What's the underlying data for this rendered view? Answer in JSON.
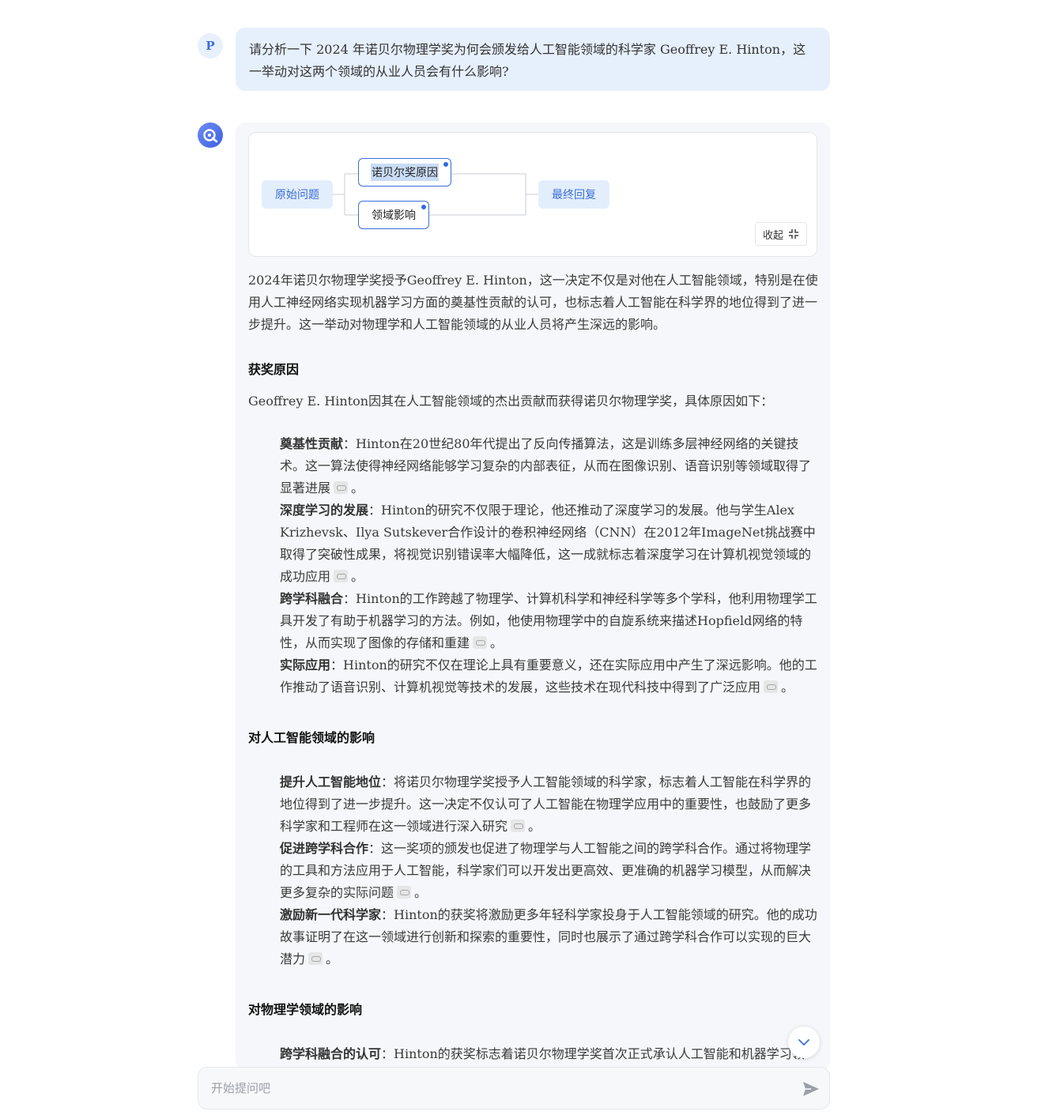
{
  "user_message": {
    "avatar_letter": "P",
    "text": "请分析一下 2024 年诺贝尔物理学奖为何会颁发给人工智能领域的科学家 Geoffrey E. Hinton，这一举动对这两个领域的从业人员会有什么影响?"
  },
  "flow": {
    "start": "原始问题",
    "branches": [
      "诺贝尔奖原因",
      "领域影响"
    ],
    "end": "最终回复",
    "collapse_label": "收起"
  },
  "answer": {
    "intro": "2024年诺贝尔物理学奖授予Geoffrey E. Hinton，这一决定不仅是对他在人工智能领域，特别是在使用人工神经网络实现机器学习方面的奠基性贡献的认可，也标志着人工智能在科学界的地位得到了进一步提升。这一举动对物理学和人工智能领域的从业人员将产生深远的影响。",
    "sections": [
      {
        "title": "获奖原因",
        "lead": "Geoffrey E. Hinton因其在人工智能领域的杰出贡献而获得诺贝尔物理学奖，具体原因如下：",
        "items": [
          {
            "label": "奠基性贡献",
            "sep": "：",
            "text": "Hinton在20世纪80年代提出了反向传播算法，这是训练多层神经网络的关键技术。这一算法使得神经网络能够学习复杂的内部表征，从而在图像识别、语音识别等领域取得了显著进展",
            "end": "。"
          },
          {
            "label": "深度学习的发展",
            "sep": "：",
            "text": "Hinton的研究不仅限于理论，他还推动了深度学习的发展。他与学生Alex Krizhevsk、Ilya Sutskever合作设计的卷积神经网络（CNN）在2012年ImageNet挑战赛中取得了突破性成果，将视觉识别错误率大幅降低，这一成就标志着深度学习在计算机视觉领域的成功应用",
            "end": "。"
          },
          {
            "label": "跨学科融合",
            "sep": "：",
            "text": "Hinton的工作跨越了物理学、计算机科学和神经科学等多个学科，他利用物理学工具开发了有助于机器学习的方法。例如，他使用物理学中的自旋系统来描述Hopfield网络的特性，从而实现了图像的存储和重建",
            "end": "。"
          },
          {
            "label": "实际应用",
            "sep": "：",
            "text": "Hinton的研究不仅在理论上具有重要意义，还在实际应用中产生了深远影响。他的工作推动了语音识别、计算机视觉等技术的发展，这些技术在现代科技中得到了广泛应用",
            "end": "。"
          }
        ]
      },
      {
        "title": "对人工智能领域的影响",
        "items": [
          {
            "label": "提升人工智能地位",
            "sep": "：",
            "text": "将诺贝尔物理学奖授予人工智能领域的科学家，标志着人工智能在科学界的地位得到了进一步提升。这一决定不仅认可了人工智能在物理学应用中的重要性，也鼓励了更多科学家和工程师在这一领域进行深入研究",
            "end": "。"
          },
          {
            "label": "促进跨学科合作",
            "sep": "：",
            "text": "这一奖项的颁发也促进了物理学与人工智能之间的跨学科合作。通过将物理学的工具和方法应用于人工智能，科学家们可以开发出更高效、更准确的机器学习模型，从而解决更多复杂的实际问题",
            "end": "。"
          },
          {
            "label": "激励新一代科学家",
            "sep": "：",
            "text": "Hinton的获奖将激励更多年轻科学家投身于人工智能领域的研究。他的成功故事证明了在这一领域进行创新和探索的重要性，同时也展示了通过跨学科合作可以实现的巨大潜力",
            "end": "。"
          }
        ]
      },
      {
        "title": "对物理学领域的影响",
        "items": [
          {
            "label": "跨学科融合的认可",
            "sep": "：",
            "text": "Hinton的获奖标志着诺贝尔物理学奖首次正式承认人工智能和机器学习领",
            "end": ""
          }
        ]
      }
    ]
  },
  "input": {
    "placeholder": "开始提问吧"
  }
}
